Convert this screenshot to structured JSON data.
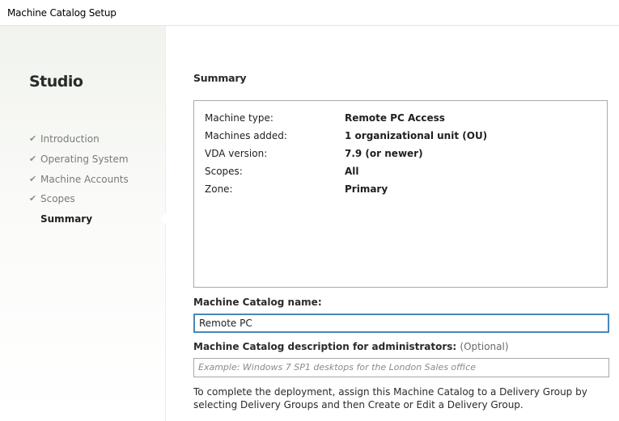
{
  "window": {
    "title": "Machine Catalog Setup"
  },
  "sidebar": {
    "brand": "Studio",
    "steps": [
      {
        "label": "Introduction",
        "completed": true,
        "icon": "check-icon"
      },
      {
        "label": "Operating System",
        "completed": true,
        "icon": "check-icon"
      },
      {
        "label": "Machine Accounts",
        "completed": true,
        "icon": "check-icon"
      },
      {
        "label": "Scopes",
        "completed": true,
        "icon": "check-icon"
      },
      {
        "label": "Summary",
        "completed": false,
        "current": true
      }
    ]
  },
  "main": {
    "title": "Summary",
    "summary": [
      {
        "key": "Machine type:",
        "value": "Remote PC Access"
      },
      {
        "key": "Machines added:",
        "value": "1 organizational unit (OU)"
      },
      {
        "key": "VDA version:",
        "value": "7.9 (or newer)"
      },
      {
        "key": "Scopes:",
        "value": "All"
      },
      {
        "key": "Zone:",
        "value": "Primary"
      }
    ],
    "catalog_name": {
      "label": "Machine Catalog name:",
      "value": "Remote PC"
    },
    "description": {
      "label": "Machine Catalog description for administrators:",
      "optional": "(Optional)",
      "placeholder": "Example: Windows 7 SP1 desktops for the London Sales office",
      "value": ""
    },
    "instructions": "To complete the deployment, assign this Machine Catalog to a Delivery Group by selecting Delivery Groups and then Create or Edit a Delivery Group."
  },
  "colors": {
    "focus_border": "#4b87b8",
    "sidebar_bg": "#f1f3ee"
  }
}
